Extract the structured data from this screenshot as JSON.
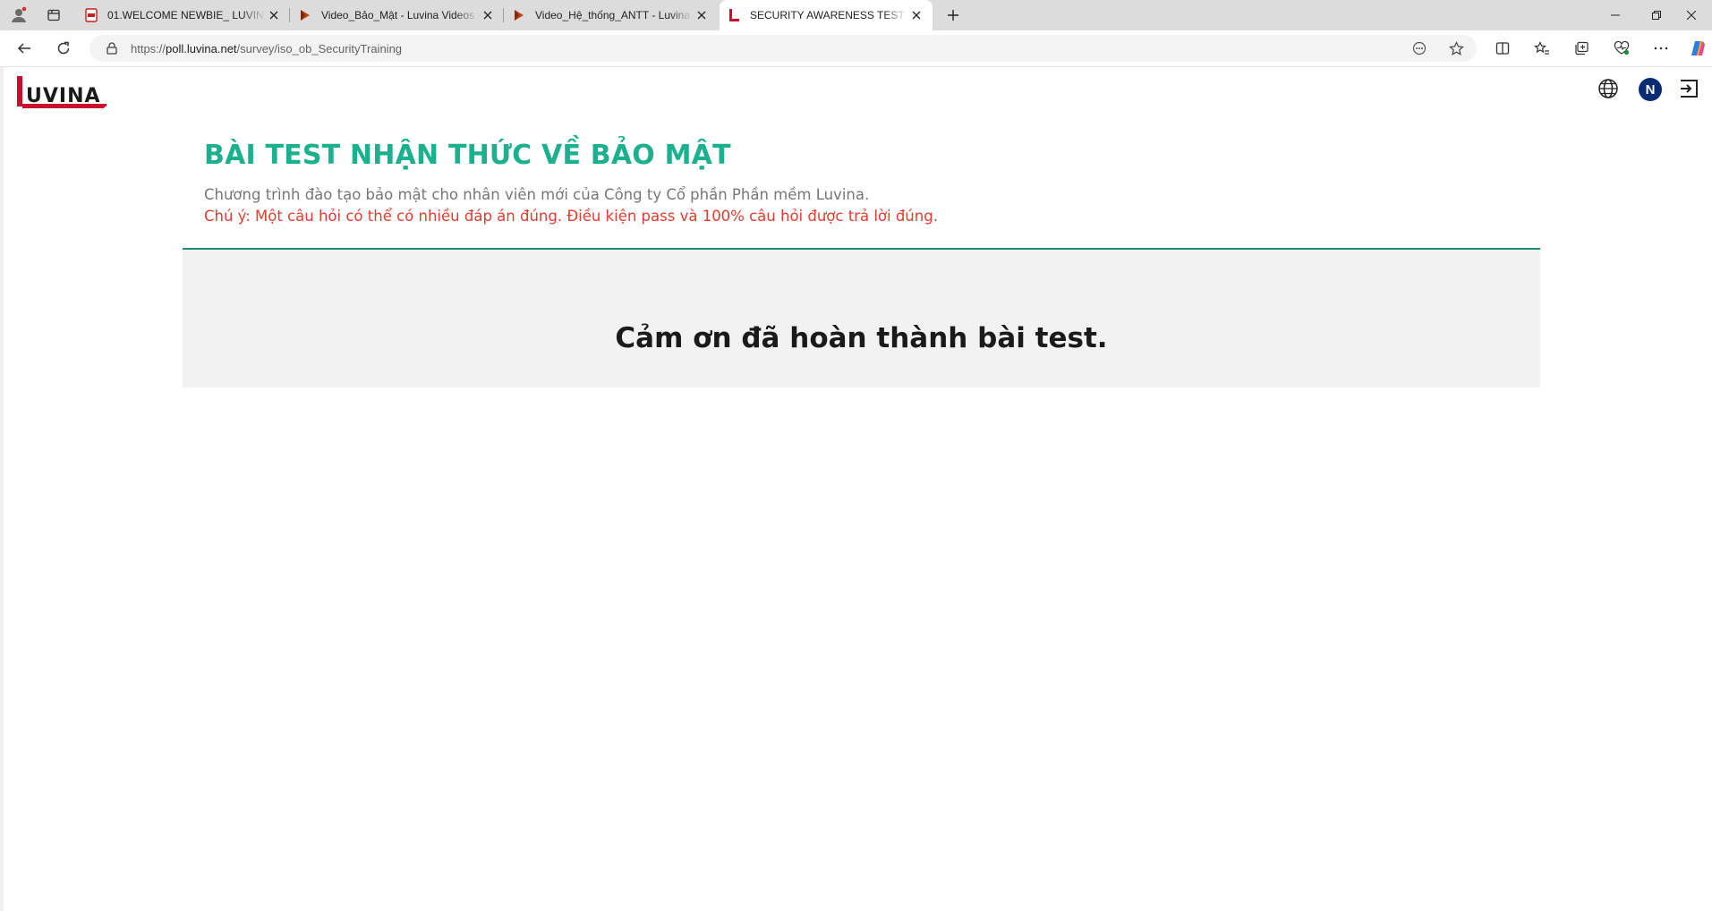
{
  "browser": {
    "tabs": [
      {
        "title": "01.WELCOME NEWBIE_ LUVINA_ ...",
        "favicon": "pdf-icon",
        "active": false
      },
      {
        "title": "Video_Bảo_Mật - Luvina Videos S...",
        "favicon": "stream-play-icon",
        "active": false
      },
      {
        "title": "Video_Hệ_thống_ANTT - Luvina V...",
        "favicon": "stream-play-icon",
        "active": false
      },
      {
        "title": "SECURITY AWARENESS TEST - Sur...",
        "favicon": "luvina-favicon",
        "active": true
      }
    ],
    "address": {
      "url_prefix": "https://",
      "url_host": "poll.luvina.net",
      "url_path": "/survey/iso_ob_SecurityTraining"
    }
  },
  "header": {
    "logo_text": "LUVINA",
    "avatar_initial": "N"
  },
  "survey": {
    "title": "BÀI TEST NHẬN THỨC VỀ BẢO MẬT",
    "description": "Chương trình đào tạo bảo mật cho nhân viên mới của Công ty Cổ phần Phần mềm Luvina.",
    "note": "Chú ý: Một câu hỏi có thể có nhiều đáp án đúng. Điều kiện pass và 100% câu hỏi được trả lời đúng.",
    "completion_message": "Cảm ơn đã hoàn thành bài test."
  },
  "colors": {
    "title": "#1bb08e",
    "note": "#e23d2f",
    "divider": "#1c8d72",
    "panel": "#f2f2f2",
    "avatar": "#0b2a74"
  }
}
